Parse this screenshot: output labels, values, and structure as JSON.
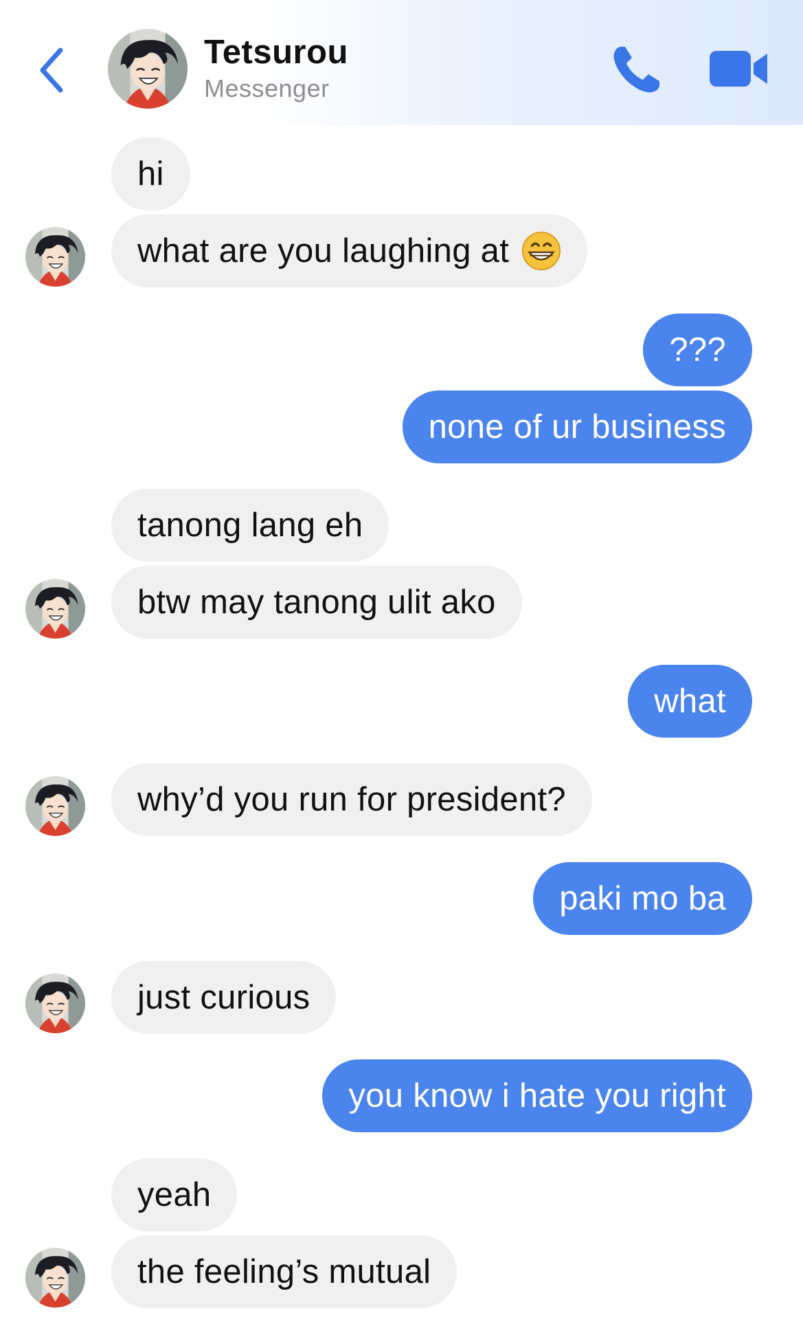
{
  "header": {
    "title": "Tetsurou",
    "subtitle": "Messenger",
    "icons": {
      "back": "chevron-left-icon",
      "call": "phone-icon",
      "video": "video-camera-icon"
    },
    "accent_color": "#3b76e8"
  },
  "messages": [
    {
      "sender": "contact",
      "text": "hi"
    },
    {
      "sender": "contact",
      "text": "what are you laughing at",
      "emoji": "grinning-face-icon"
    },
    {
      "sender": "me",
      "text": "???"
    },
    {
      "sender": "me",
      "text": "none of ur business"
    },
    {
      "sender": "contact",
      "text": "tanong lang eh"
    },
    {
      "sender": "contact",
      "text": "btw may tanong ulit ako"
    },
    {
      "sender": "me",
      "text": "what"
    },
    {
      "sender": "contact",
      "text": "why’d you run for president?"
    },
    {
      "sender": "me",
      "text": "paki mo ba"
    },
    {
      "sender": "contact",
      "text": "just curious"
    },
    {
      "sender": "me",
      "text": "you know i hate you right"
    },
    {
      "sender": "contact",
      "text": "yeah"
    },
    {
      "sender": "contact",
      "text": "the feeling’s mutual"
    }
  ],
  "colors": {
    "incoming_bubble": "#f0f0f0",
    "outgoing_bubble": "#4a84ec",
    "incoming_text": "#111111",
    "outgoing_text": "#ffffff"
  }
}
